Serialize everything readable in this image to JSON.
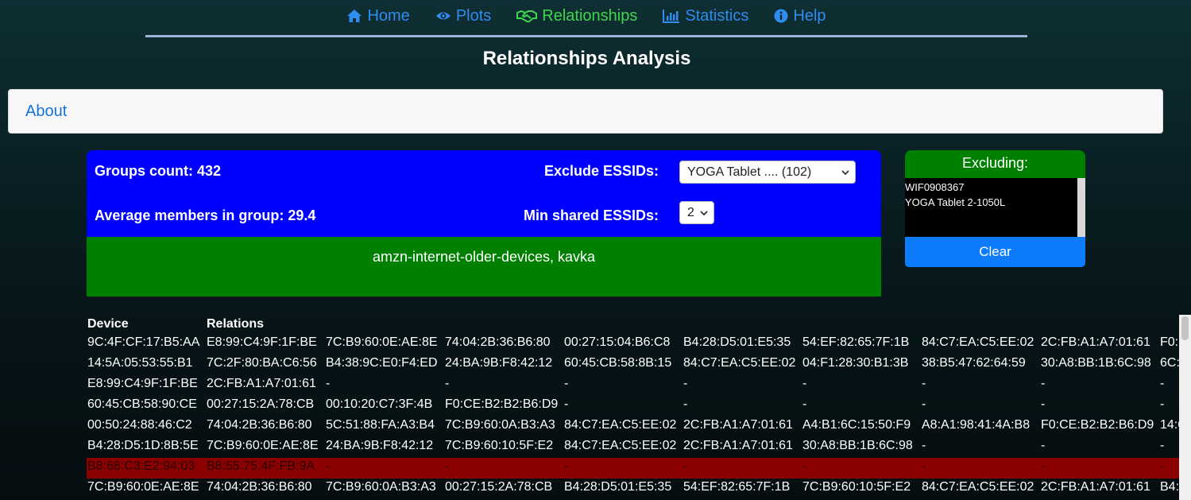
{
  "nav": {
    "items": [
      {
        "label": "Home",
        "icon": "home-icon",
        "active": false
      },
      {
        "label": "Plots",
        "icon": "eye-icon",
        "active": false
      },
      {
        "label": "Relationships",
        "icon": "handshake-icon",
        "active": true
      },
      {
        "label": "Statistics",
        "icon": "bar-chart-icon",
        "active": false
      },
      {
        "label": "Help",
        "icon": "info-icon",
        "active": false
      }
    ]
  },
  "page": {
    "title": "Relationships Analysis"
  },
  "about": {
    "label": "About"
  },
  "panel": {
    "groups_count": "Groups count: 432",
    "avg_members": "Average members in group: 29.4",
    "exclude_label": "Exclude ESSIDs:",
    "exclude_value": "YOGA Tablet .... (102)",
    "min_shared_label": "Min shared ESSIDs:",
    "min_shared_value": "2",
    "shared_essids": "amzn-internet-older-devices, kavka"
  },
  "excluding": {
    "title": "Excluding:",
    "items": [
      "WIF0908367",
      "YOGA Tablet 2-1050L"
    ],
    "clear_label": "Clear"
  },
  "table": {
    "headers": {
      "device": "Device",
      "relations": "Relations"
    },
    "rows": [
      {
        "device": "9C:4F:CF:17:B5:AA",
        "relations": [
          "E8:99:C4:9F:1F:BE",
          "7C:B9:60:0E:AE:8E",
          "74:04:2B:36:B6:80",
          "00:27:15:04:B6:C8",
          "B4:28:D5:01:E5:35",
          "54:EF:82:65:7F:1B",
          "84:C7:EA:C5:EE:02",
          "2C:FB:A1:A7:01:61",
          "F0:"
        ],
        "highlight": false
      },
      {
        "device": "14:5A:05:53:55:B1",
        "relations": [
          "7C:2F:80:BA:C6:56",
          "B4:38:9C:E0:F4:ED",
          "24:BA:9B:F8:42:12",
          "60:45:CB:58:8B:15",
          "84:C7:EA:C5:EE:02",
          "04:F1:28:30:B1:3B",
          "38:B5:47:62:64:59",
          "30:A8:BB:1B:6C:98",
          "6C:"
        ],
        "highlight": false
      },
      {
        "device": "E8:99:C4:9F:1F:BE",
        "relations": [
          "2C:FB:A1:A7:01:61",
          "-",
          "-",
          "-",
          "-",
          "-",
          "-",
          "-",
          "-"
        ],
        "highlight": false
      },
      {
        "device": "60:45:CB:58:90:CE",
        "relations": [
          "00:27:15:2A:78:CB",
          "00:10:20:C7:3F:4B",
          "F0:CE:B2:B2:B6:D9",
          "-",
          "-",
          "-",
          "-",
          "-",
          "-"
        ],
        "highlight": false
      },
      {
        "device": "00:50:24:88:46:C2",
        "relations": [
          "74:04:2B:36:B6:80",
          "5C:51:88:FA:A3:B4",
          "7C:B9:60:0A:B3:A3",
          "84:C7:EA:C5:EE:02",
          "2C:FB:A1:A7:01:61",
          "A4:B1:6C:15:50:F9",
          "A8:A1:98:41:4A:B8",
          "F0:CE:B2:B2:B6:D9",
          "14:6"
        ],
        "highlight": false
      },
      {
        "device": "B4:28:D5:1D:8B:5E",
        "relations": [
          "7C:B9:60:0E:AE:8E",
          "24:BA:9B:F8:42:12",
          "7C:B9:60:10:5F:E2",
          "84:C7:EA:C5:EE:02",
          "2C:FB:A1:A7:01:61",
          "30:A8:BB:1B:6C:98",
          "-",
          "-",
          "-"
        ],
        "highlight": false
      },
      {
        "device": "B8:68:C3:E2:94:03",
        "relations": [
          "B8:55:75:4F:FB:9A",
          "-",
          "-",
          "-",
          "-",
          "-",
          "-",
          "-",
          "-"
        ],
        "highlight": true
      },
      {
        "device": "7C:B9:60:0E:AE:8E",
        "relations": [
          "74:04:2B:36:B6:80",
          "7C:B9:60:0A:B3:A3",
          "00:27:15:2A:78:CB",
          "B4:28:D5:01:E5:35",
          "54:EF:82:65:7F:1B",
          "7C:B9:60:10:5F:E2",
          "84:C7:EA:C5:EE:02",
          "2C:FB:A1:A7:01:61",
          "B4:"
        ],
        "highlight": false
      }
    ]
  },
  "colors": {
    "nav_link": "#2f8cf0",
    "nav_active": "#3fd64f",
    "panel_blue": "#0000ff",
    "panel_green": "#008000",
    "highlight_row": "#8b0000",
    "clear_button": "#0d7cfa"
  }
}
